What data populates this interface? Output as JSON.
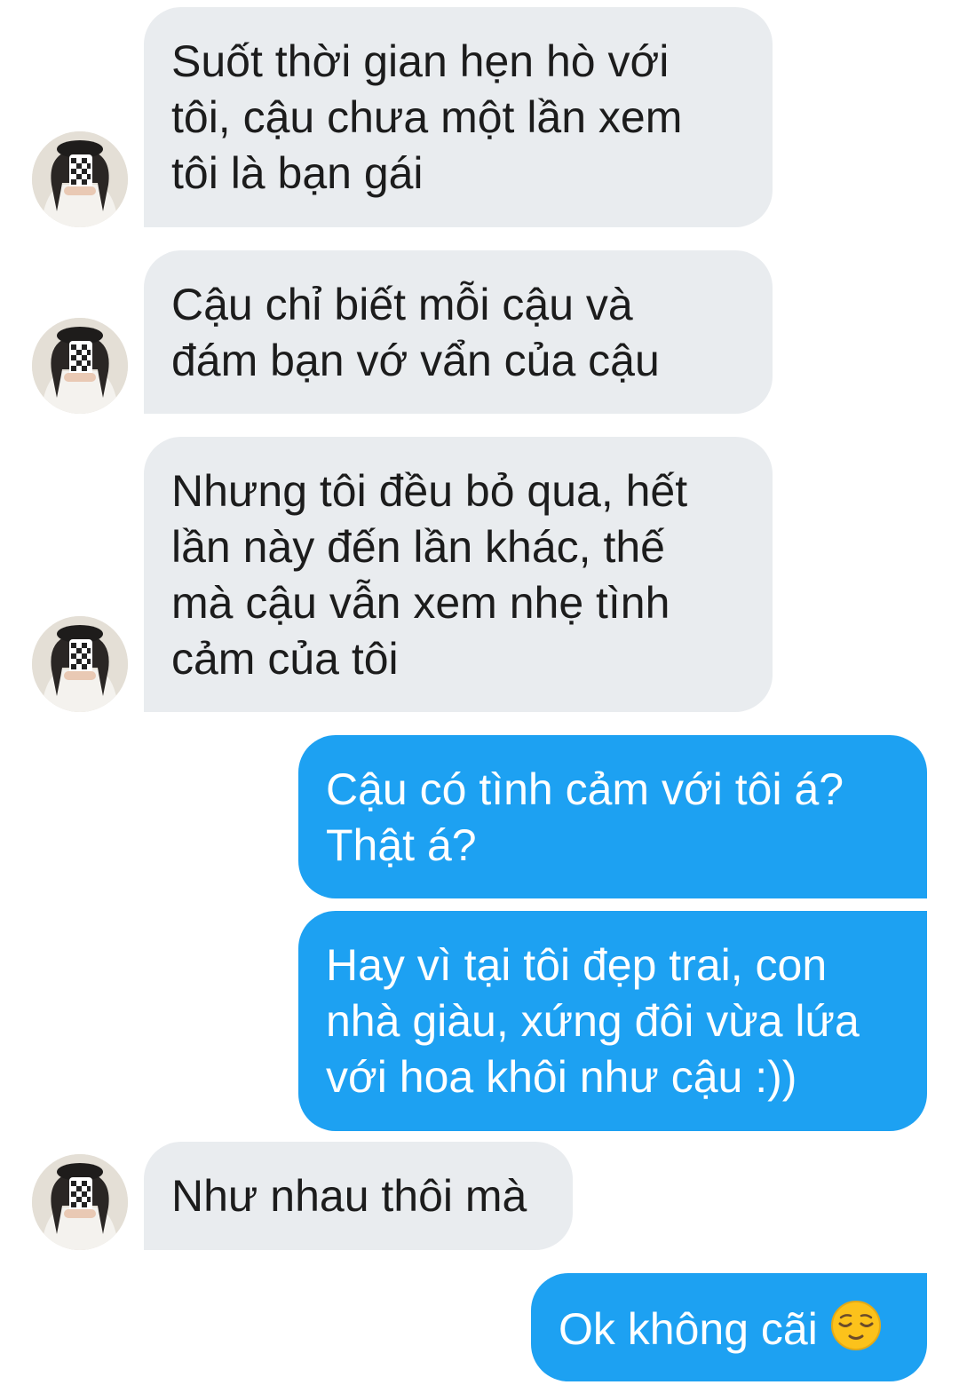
{
  "colors": {
    "incoming_bubble": "#e9ecef",
    "outgoing_bubble": "#1da1f2",
    "incoming_text": "#1c1c1c",
    "outgoing_text": "#ffffff"
  },
  "contact": {
    "avatar_icon": "girl-profile-photo"
  },
  "messages": [
    {
      "direction": "incoming",
      "text": "Suốt thời gian hẹn hò với\ntôi, cậu chưa một lần xem\ntôi là bạn gái"
    },
    {
      "direction": "incoming",
      "text": "Cậu chỉ biết mỗi cậu và\nđám bạn vớ vẩn của cậu"
    },
    {
      "direction": "incoming",
      "text": "Nhưng tôi đều bỏ qua, hết\nlần này đến lần khác, thế\nmà cậu vẫn xem nhẹ tình\ncảm của tôi"
    },
    {
      "direction": "outgoing",
      "text": "Cậu có tình cảm với tôi á?\nThật á?"
    },
    {
      "direction": "outgoing",
      "text": "Hay vì tại tôi đẹp trai, con\nnhà giàu, xứng đôi vừa lứa\nvới hoa khôi như cậu :))"
    },
    {
      "direction": "incoming",
      "text": "Như nhau thôi mà"
    },
    {
      "direction": "outgoing",
      "text": "Ok không cãi",
      "emoji": "relieved-face-icon"
    }
  ]
}
